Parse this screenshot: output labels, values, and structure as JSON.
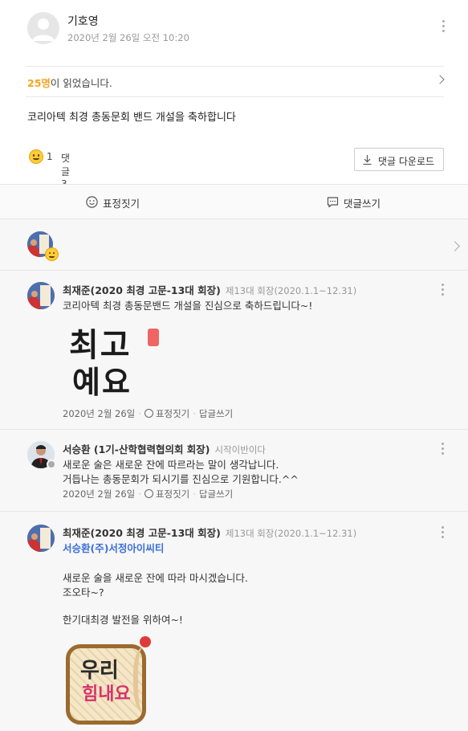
{
  "post": {
    "author_name": "기호영",
    "date": "2020년 2월 26일 오전 10:20",
    "readers_count": "25명",
    "readers_suffix": "이 읽었습니다.",
    "body": "코리아텍 최경 총동문회 밴드 개설을 축하합니다",
    "reaction_count": "1",
    "comment_count": "댓글 3",
    "download_label": "댓글 다운로드"
  },
  "actions": {
    "react_label": "표정짓기",
    "comment_label": "댓글쓰기"
  },
  "comments": [
    {
      "name": "최재준(2020 최경 고문-13대 회장)",
      "role": "제13대 회장(2020.1.1~12.31)",
      "lines": [
        "코리아텍 최경 총동문밴드 개설을 진심으로 축하드립니다~!"
      ],
      "sticker_text": [
        "최고",
        "예요"
      ],
      "date": "2020년 2월 26일",
      "react_label": "표정짓기",
      "reply_label": "답글쓰기"
    },
    {
      "name": "서승환 (1기-산학협력협의회 회장)",
      "role": "시작이반이다",
      "lines": [
        "새로운 술은 새로운 잔에 따르라는 말이 생각납니다.",
        "거듭나는 총동문회가 되시기를 진심으로 기원합니다.^^"
      ],
      "date": "2020년 2월 26일",
      "react_label": "표정짓기",
      "reply_label": "답글쓰기"
    },
    {
      "name": "최재준(2020 최경 고문-13대 회장)",
      "role": "제13대 회장(2020.1.1~12.31)",
      "mention": "서승환(주)서정아이씨티",
      "lines": [
        "새로운 술을 새로운 잔에 따라 마시겠습니다.",
        "조오타~?",
        "",
        "한기대최경 발전을 위하여~!"
      ],
      "sticker_text": [
        "우리",
        "힘내요"
      ]
    }
  ],
  "colors": {
    "accent": "#f5a623",
    "mention": "#3b6ed9"
  }
}
